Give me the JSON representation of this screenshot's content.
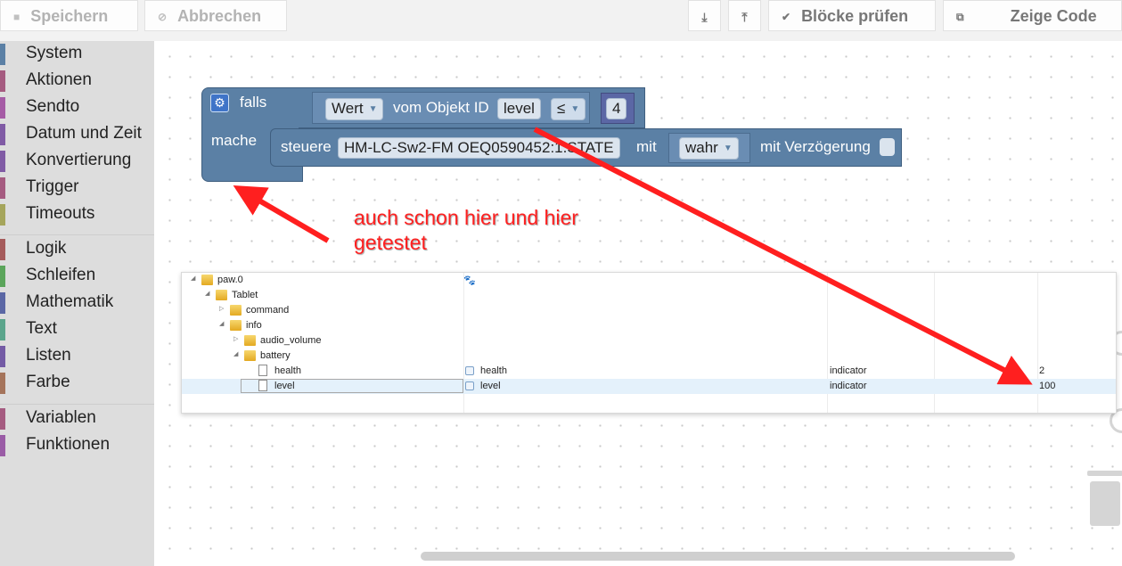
{
  "toolbar": {
    "save": "Speichern",
    "cancel": "Abbrechen",
    "check": "Blöcke prüfen",
    "show_code": "Zeige Code"
  },
  "sidebar": {
    "categories": [
      {
        "label": "System",
        "color": "#5b80a5"
      },
      {
        "label": "Aktionen",
        "color": "#a55b80"
      },
      {
        "label": "Sendto",
        "color": "#a55ba5"
      },
      {
        "label": "Datum und Zeit",
        "color": "#805ba5"
      },
      {
        "label": "Konvertierung",
        "color": "#805ba5"
      },
      {
        "label": "Trigger",
        "color": "#a55b80"
      },
      {
        "label": "Timeouts",
        "color": "#a5a55b"
      },
      {
        "label": "Logik",
        "color": "#a55b5b"
      },
      {
        "label": "Schleifen",
        "color": "#5ba55b"
      },
      {
        "label": "Mathematik",
        "color": "#5b67a5"
      },
      {
        "label": "Text",
        "color": "#5ba58c"
      },
      {
        "label": "Listen",
        "color": "#745ba5"
      },
      {
        "label": "Farbe",
        "color": "#a5745b"
      },
      {
        "label": "Variablen",
        "color": "#a55b80"
      },
      {
        "label": "Funktionen",
        "color": "#9a5ca6"
      }
    ]
  },
  "blocks": {
    "if_label": "falls",
    "do_label": "mache",
    "value_dropdown": "Wert",
    "object_text": "vom Objekt ID",
    "object_id": "level",
    "operator": "≤",
    "compare_value": "4",
    "control_label": "steuere",
    "control_target": "HM-LC-Sw2-FM OEQ0590452:1.STATE",
    "with_label": "mit",
    "with_value": "wahr",
    "delay_label": "mit Verzögerung"
  },
  "annotation": {
    "line1": "auch schon hier und hier",
    "line2": "getestet"
  },
  "tree": {
    "rows": [
      {
        "name": "paw.0",
        "object_name": "",
        "role": "",
        "value": ""
      },
      {
        "name": "Tablet",
        "object_name": "",
        "role": "",
        "value": ""
      },
      {
        "name": "command",
        "object_name": "",
        "role": "",
        "value": ""
      },
      {
        "name": "info",
        "object_name": "",
        "role": "",
        "value": ""
      },
      {
        "name": "audio_volume",
        "object_name": "",
        "role": "",
        "value": ""
      },
      {
        "name": "battery",
        "object_name": "",
        "role": "",
        "value": ""
      },
      {
        "name": "health",
        "object_name": "health",
        "role": "indicator",
        "value": "2"
      },
      {
        "name": "level",
        "object_name": "level",
        "role": "indicator",
        "value": "100"
      }
    ],
    "header_icon": "paw-icon"
  },
  "colors": {
    "block": "#5b80a5",
    "annotation": "#ff2020",
    "selected_row": "#e4f1fb"
  }
}
